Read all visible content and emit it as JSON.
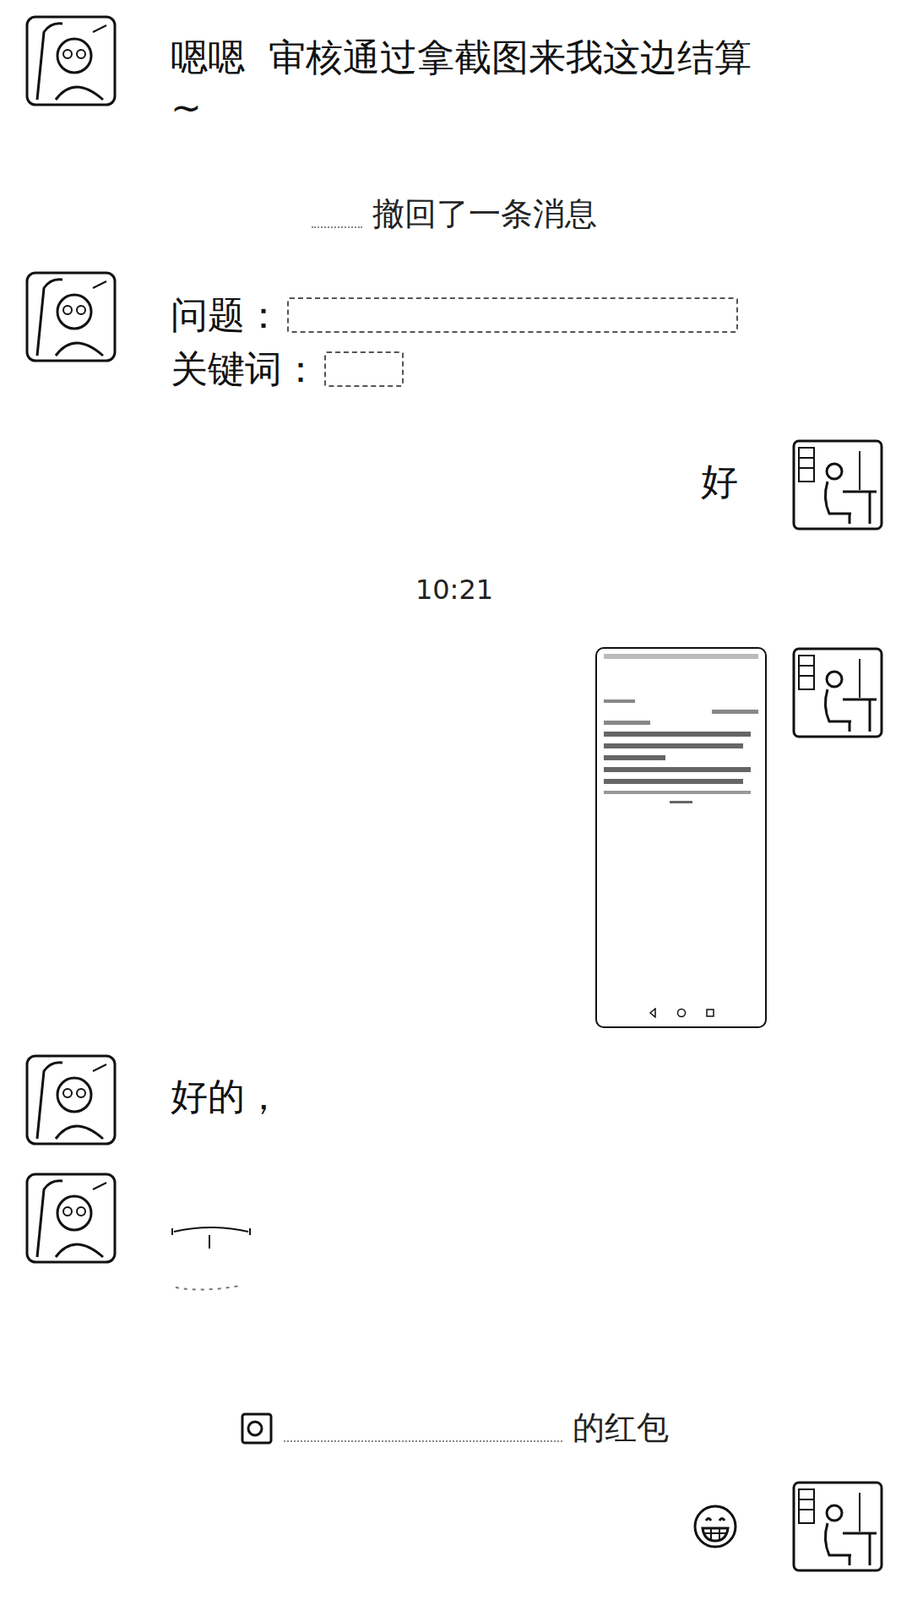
{
  "messages": [
    {
      "kind": "text",
      "side": "left",
      "text": "嗯嗯  审核通过拿截图来我这边结算 ~"
    },
    {
      "kind": "notice",
      "text": "撤回了一条消息"
    },
    {
      "kind": "fields",
      "side": "left",
      "fields": [
        "问题：",
        "关键词："
      ]
    },
    {
      "kind": "text",
      "side": "right",
      "text": "好"
    },
    {
      "kind": "time",
      "text": "10:21"
    },
    {
      "kind": "image",
      "side": "right"
    },
    {
      "kind": "text",
      "side": "left",
      "text": "好的，"
    },
    {
      "kind": "sticker",
      "side": "left"
    },
    {
      "kind": "packet",
      "text": "的红包"
    },
    {
      "kind": "emoji",
      "side": "right"
    }
  ]
}
